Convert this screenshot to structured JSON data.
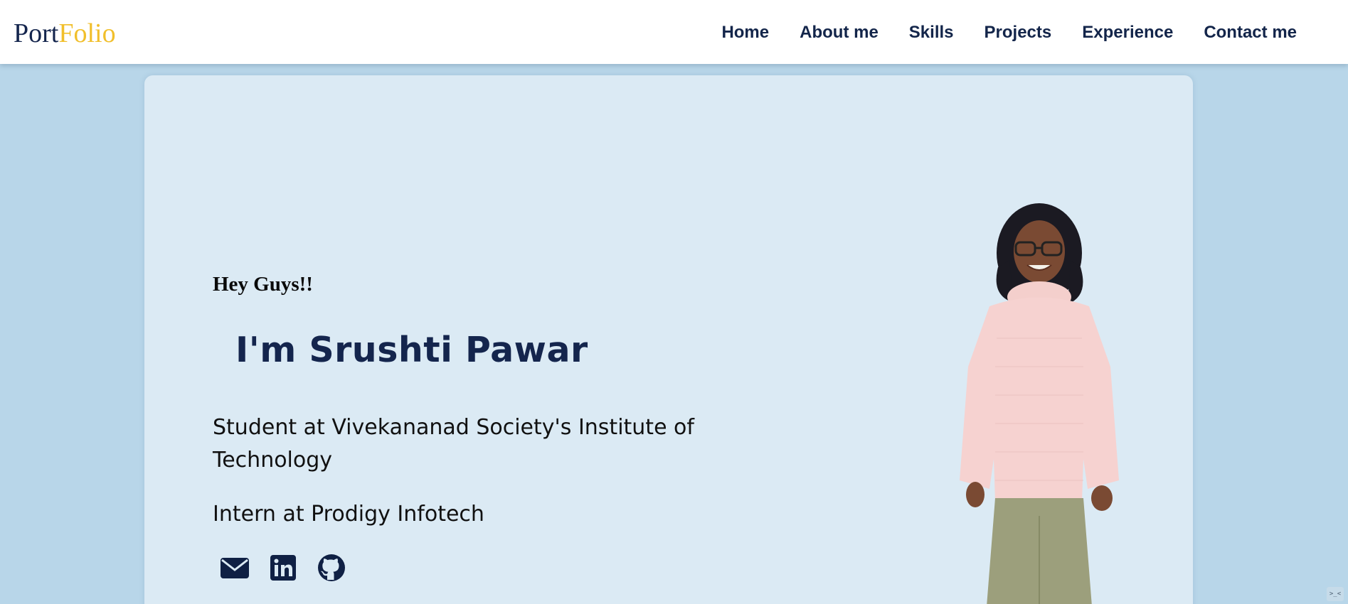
{
  "brand": {
    "logo_part1": "Port",
    "logo_part2": "Folio",
    "accent_color": "#f1bf2b",
    "primary_color": "#14254d"
  },
  "nav": {
    "items": [
      {
        "label": "Home"
      },
      {
        "label": "About me"
      },
      {
        "label": "Skills"
      },
      {
        "label": "Projects"
      },
      {
        "label": "Experience"
      },
      {
        "label": "Contact me"
      }
    ]
  },
  "hero": {
    "greeting": "Hey Guys!!",
    "name": "I'm Srushti Pawar",
    "role_1": "Student at Vivekananad Society's Institute of Technology",
    "role_2": "Intern at Prodigy Infotech",
    "socials": [
      {
        "icon": "envelope-icon"
      },
      {
        "icon": "linkedin-icon"
      },
      {
        "icon": "github-icon"
      }
    ],
    "portrait": "profile-photo"
  },
  "corner_widget": {
    "glyph": ">_<"
  },
  "colors": {
    "page_bg": "#b8d6e9",
    "card_bg": "#dbeaf4",
    "navbar_bg": "#ffffff"
  }
}
